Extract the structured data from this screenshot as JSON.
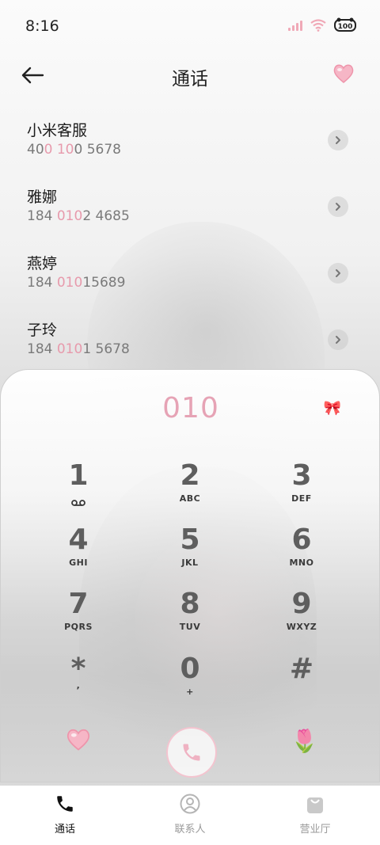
{
  "status_bar": {
    "time": "8:16",
    "battery_level": "100",
    "accent_color": "#f0a9b7"
  },
  "header": {
    "title": "通话",
    "back_icon": "back-arrow-icon",
    "right_icon": "heart-icon"
  },
  "contacts": [
    {
      "name": "小米客服",
      "number_parts": [
        "40",
        "0 10",
        "0 5678"
      ]
    },
    {
      "name": "雅娜",
      "number_parts": [
        "184 ",
        "010",
        "2 4685"
      ]
    },
    {
      "name": "燕婷",
      "number_parts": [
        "184 ",
        "010",
        "15689"
      ]
    },
    {
      "name": "子玲",
      "number_parts": [
        "184 ",
        "010",
        "1 5678"
      ]
    }
  ],
  "dialpad": {
    "typed_number": "010",
    "typed_color": "#e6a3b5",
    "keys": [
      {
        "digit": "1",
        "letters": ""
      },
      {
        "digit": "2",
        "letters": "ABC"
      },
      {
        "digit": "3",
        "letters": "DEF"
      },
      {
        "digit": "4",
        "letters": "GHI"
      },
      {
        "digit": "5",
        "letters": "JKL"
      },
      {
        "digit": "6",
        "letters": "MNO"
      },
      {
        "digit": "7",
        "letters": "PQRS"
      },
      {
        "digit": "8",
        "letters": "TUV"
      },
      {
        "digit": "9",
        "letters": "WXYZ"
      },
      {
        "digit": "*",
        "letters": ","
      },
      {
        "digit": "0",
        "letters": "+"
      },
      {
        "digit": "#",
        "letters": ""
      }
    ]
  },
  "tabs": [
    {
      "label": "通话",
      "icon": "phone-icon",
      "active": true
    },
    {
      "label": "联系人",
      "icon": "contacts-icon",
      "active": false
    },
    {
      "label": "营业厅",
      "icon": "shopping-bag-icon",
      "active": false
    }
  ]
}
